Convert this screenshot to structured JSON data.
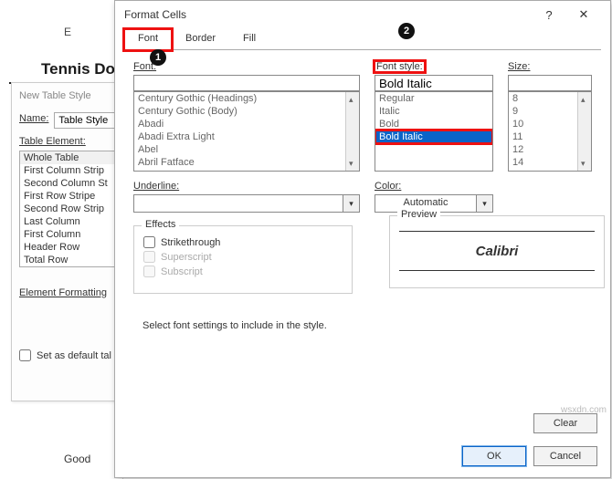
{
  "sheet": {
    "col": "E",
    "heading": "Tennis Do",
    "status": "Good"
  },
  "dlg_style": {
    "title": "New Table Style",
    "name_lbl": "Name:",
    "name_val": "Table Style",
    "element_lbl": "Table Element:",
    "elements": [
      "Whole Table",
      "First Column Strip",
      "Second Column St",
      "First Row Stripe",
      "Second Row Strip",
      "Last Column",
      "First Column",
      "Header Row",
      "Total Row"
    ],
    "ef_lbl": "Element Formatting",
    "default_chk": "Set as default tal"
  },
  "dlg_format": {
    "title": "Format Cells",
    "tabs": {
      "font": "Font",
      "border": "Border",
      "fill": "Fill"
    },
    "font_lbl": "Font:",
    "fontstyle_lbl": "Font style:",
    "size_lbl": "Size:",
    "font_val": "",
    "style_val": "Bold Italic",
    "size_val": "",
    "font_options": [
      "Century Gothic (Headings)",
      "Century Gothic (Body)",
      "Abadi",
      "Abadi Extra Light",
      "Abel",
      "Abril Fatface"
    ],
    "style_options": [
      "Regular",
      "Italic",
      "Bold",
      "Bold Italic"
    ],
    "size_options": [
      "8",
      "9",
      "10",
      "11",
      "12",
      "14"
    ],
    "underline_lbl": "Underline:",
    "color_lbl": "Color:",
    "color_val": "Automatic",
    "effects_lbl": "Effects",
    "strike": "Strikethrough",
    "superscript": "Superscript",
    "subscript": "Subscript",
    "preview_lbl": "Preview",
    "preview_text": "Calibri",
    "note": "Select font settings to include in the style.",
    "clear": "Clear",
    "ok": "OK",
    "cancel": "Cancel"
  },
  "watermark": "wsxdn.com"
}
